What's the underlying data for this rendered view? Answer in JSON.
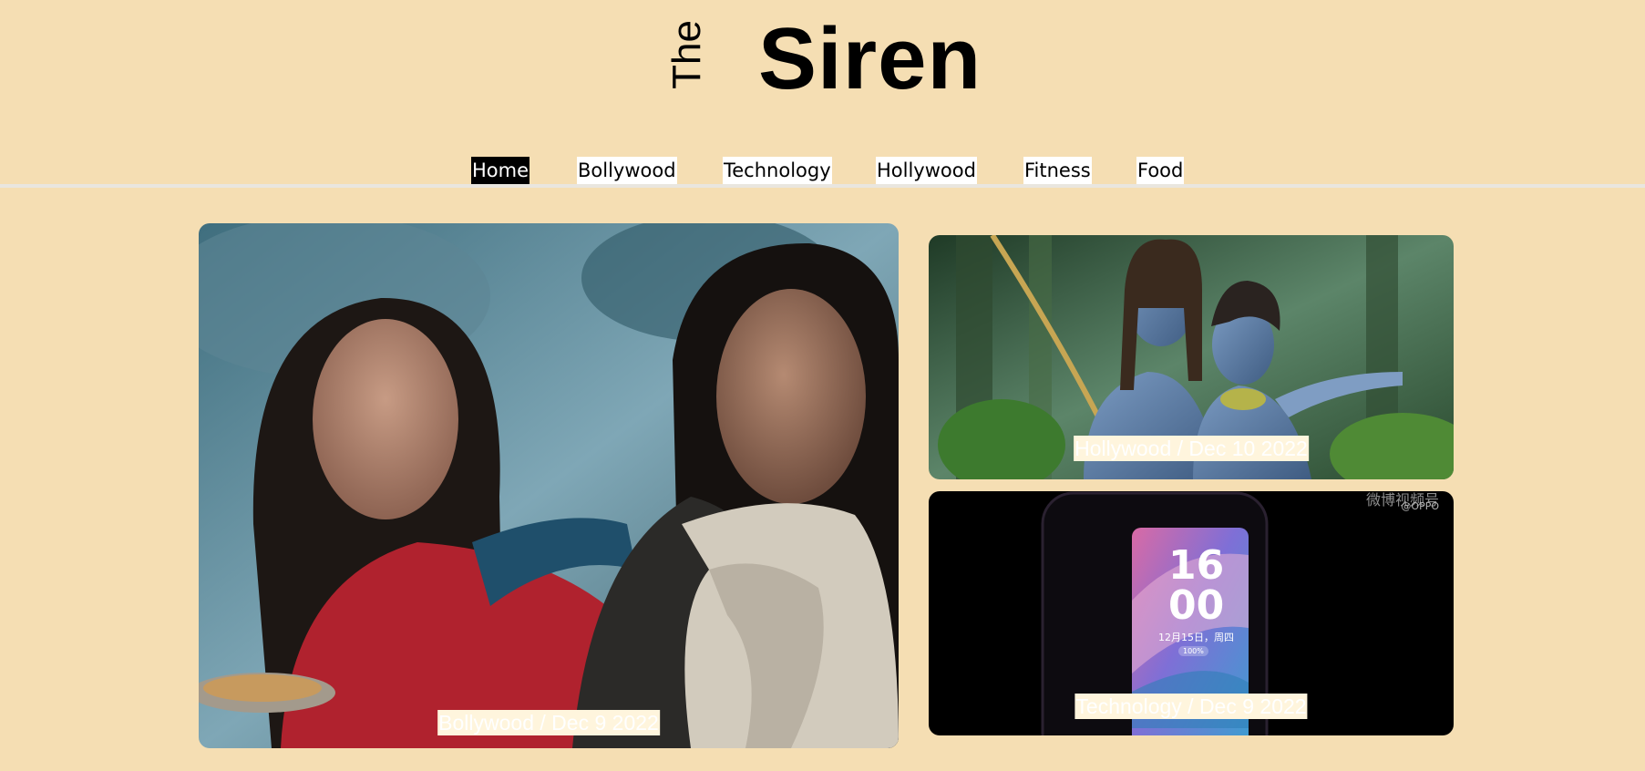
{
  "brand": {
    "prefix": "The",
    "name": "Siren"
  },
  "nav": {
    "active": "Home",
    "items": [
      {
        "label": "Home"
      },
      {
        "label": "Bollywood"
      },
      {
        "label": "Technology"
      },
      {
        "label": "Hollywood"
      },
      {
        "label": "Fitness"
      },
      {
        "label": "Food"
      }
    ]
  },
  "stories": {
    "featured": {
      "caption": "Bollywood / Dec 9 2022",
      "image": "bollywood-film-still"
    },
    "side_top": {
      "caption": "Hollywood / Dec 10 2022",
      "image": "avatar-film-still"
    },
    "side_bottom": {
      "caption": "Technology / Dec 9 2022",
      "image": "smartphone-lockscreen",
      "overlay": {
        "watermark": "微博视频号",
        "handle": "@OPPO",
        "clock_hours": "16",
        "clock_minutes": "00",
        "date": "12月15日，周四",
        "battery": "100%"
      }
    }
  },
  "colors": {
    "page_background": "#f5deb3",
    "nav_background": "#ffffff",
    "nav_active_background": "#000000",
    "nav_active_text": "#ffffff",
    "caption_background": "#fff5dd",
    "caption_text": "#ffffff"
  }
}
